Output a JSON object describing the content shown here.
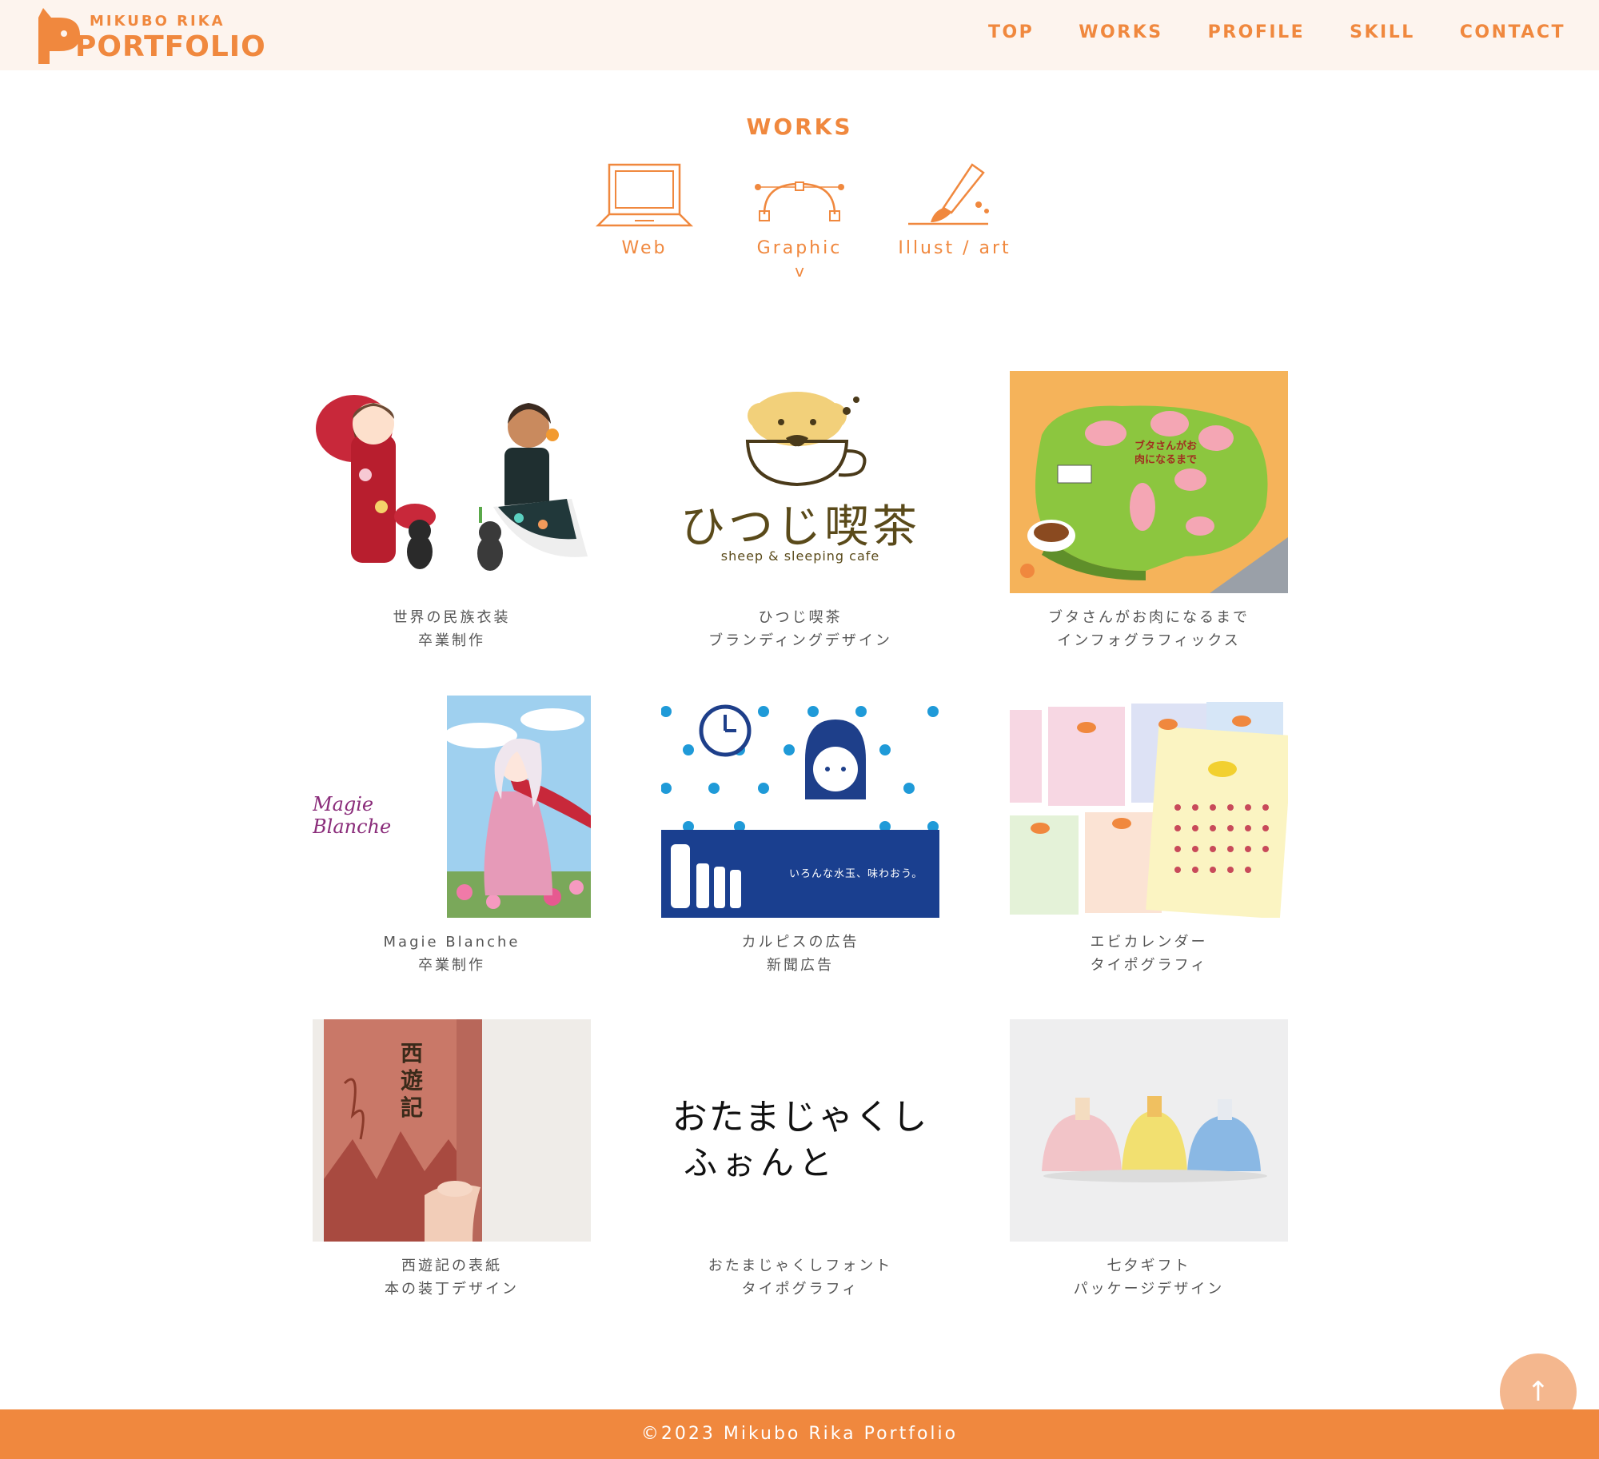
{
  "header": {
    "logo_sub": "MIKUBO RIKA",
    "logo_main": "PORTFOLIO",
    "nav": [
      "TOP",
      "WORKS",
      "PROFILE",
      "SKILL",
      "CONTACT"
    ]
  },
  "works": {
    "title": "WORKS",
    "categories": [
      {
        "label": "Web",
        "icon": "laptop-icon"
      },
      {
        "label": "Graphic",
        "icon": "bezier-curve-icon",
        "active": true
      },
      {
        "label": "Illust / art",
        "icon": "paintbrush-icon"
      }
    ],
    "active_marker": "v",
    "items": [
      {
        "line1": "世界の民族衣装",
        "line2": "卒業制作"
      },
      {
        "line1": "ひつじ喫茶",
        "line2": "ブランディングデザイン"
      },
      {
        "line1": "ブタさんがお肉になるまで",
        "line2": "インフォグラフィックス"
      },
      {
        "line1": "Magie Blanche",
        "line2": "卒業制作"
      },
      {
        "line1": "カルピスの広告",
        "line2": "新聞広告"
      },
      {
        "line1": "エビカレンダー",
        "line2": "タイポグラフィ"
      },
      {
        "line1": "西遊記の表紙",
        "line2": "本の装丁デザイン"
      },
      {
        "line1": "おたまじゃくしフォント",
        "line2": "タイポグラフィ"
      },
      {
        "line1": "七夕ギフト",
        "line2": "パッケージデザイン"
      }
    ],
    "thumb_texts": {
      "hitsuji_title": "ひつじ喫茶",
      "hitsuji_sub": "sheep & sleeping cafe",
      "buta_title": "ブタさんがお肉になるまで",
      "magie_logo": "Magie Blanche",
      "calpis_copy": "いろんな水玉、味わおう。",
      "saiyuki_title": "西遊記",
      "otama_line1": "おたまじゃくし",
      "otama_line2": "ふぉんと"
    }
  },
  "footer": {
    "copyright": "©2023 Mikubo Rika Portfolio",
    "to_top": "↑"
  },
  "colors": {
    "accent": "#f0883e",
    "header_bg": "#fdf4ee",
    "to_top_bg": "#f4b78e"
  }
}
